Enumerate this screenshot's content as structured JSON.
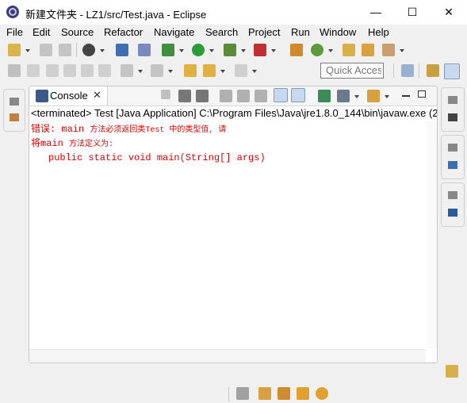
{
  "window": {
    "title": "新建文件夹 - LZ1/src/Test.java - Eclipse",
    "minimize_icon": "—",
    "maximize_icon": "☐",
    "close_icon": "✕"
  },
  "menu": [
    {
      "label": "File"
    },
    {
      "label": "Edit"
    },
    {
      "label": "Source"
    },
    {
      "label": "Refactor"
    },
    {
      "label": "Navigate"
    },
    {
      "label": "Search"
    },
    {
      "label": "Project"
    },
    {
      "label": "Run"
    },
    {
      "label": "Window"
    },
    {
      "label": "Help"
    }
  ],
  "quick_access": {
    "placeholder": "Quick Access"
  },
  "console": {
    "tab_label": "Console",
    "tab_close": "✕",
    "header": "<terminated> Test [Java Application] C:\\Program Files\\Java\\jre1.8.0_144\\bin\\javaw.exe (2",
    "lines": {
      "l1a": "错误: main ",
      "l1b": "方法必须返回类Test 中的类型值, 请",
      "l2a": "将main ",
      "l2b": "方法定义为:",
      "l3": "public static void main(String[] args)"
    }
  },
  "colors": {
    "error_text": "#dd0000",
    "title_bar": "#ffffff",
    "workbench": "#f0f0f0"
  }
}
